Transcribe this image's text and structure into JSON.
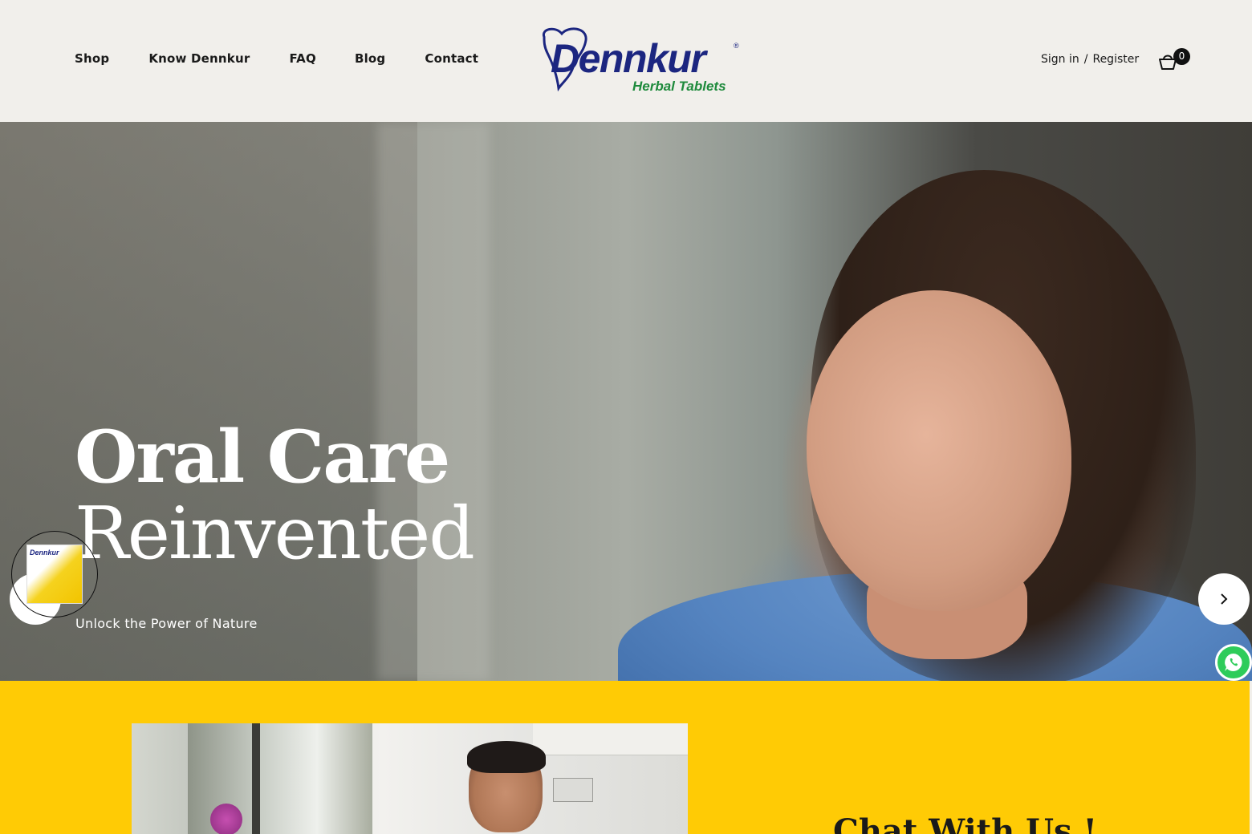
{
  "header": {
    "nav": [
      "Shop",
      "Know Dennkur",
      "FAQ",
      "Blog",
      "Contact"
    ],
    "logo": {
      "brand": "Dennkur",
      "registered": "®",
      "tagline": "Herbal Tablets",
      "brand_color": "#1c2680",
      "tagline_color": "#1e8a3c"
    },
    "account": {
      "sign_in": "Sign in",
      "separator": "/",
      "register": "Register"
    },
    "cart": {
      "icon": "basket-icon",
      "count": "0"
    }
  },
  "hero": {
    "title_line1": "Oral Care",
    "title_line2": "Reinvented",
    "subtitle": "Unlock the Power of Nature",
    "prev_icon": "chevron-left-icon",
    "next_icon": "chevron-right-icon",
    "product_badge": {
      "label": "Dennkur"
    }
  },
  "whatsapp": {
    "icon": "whatsapp-icon",
    "color": "#2ecc5a"
  },
  "chat_section": {
    "background": "#ffcb05",
    "title": "Chat With Us !"
  }
}
